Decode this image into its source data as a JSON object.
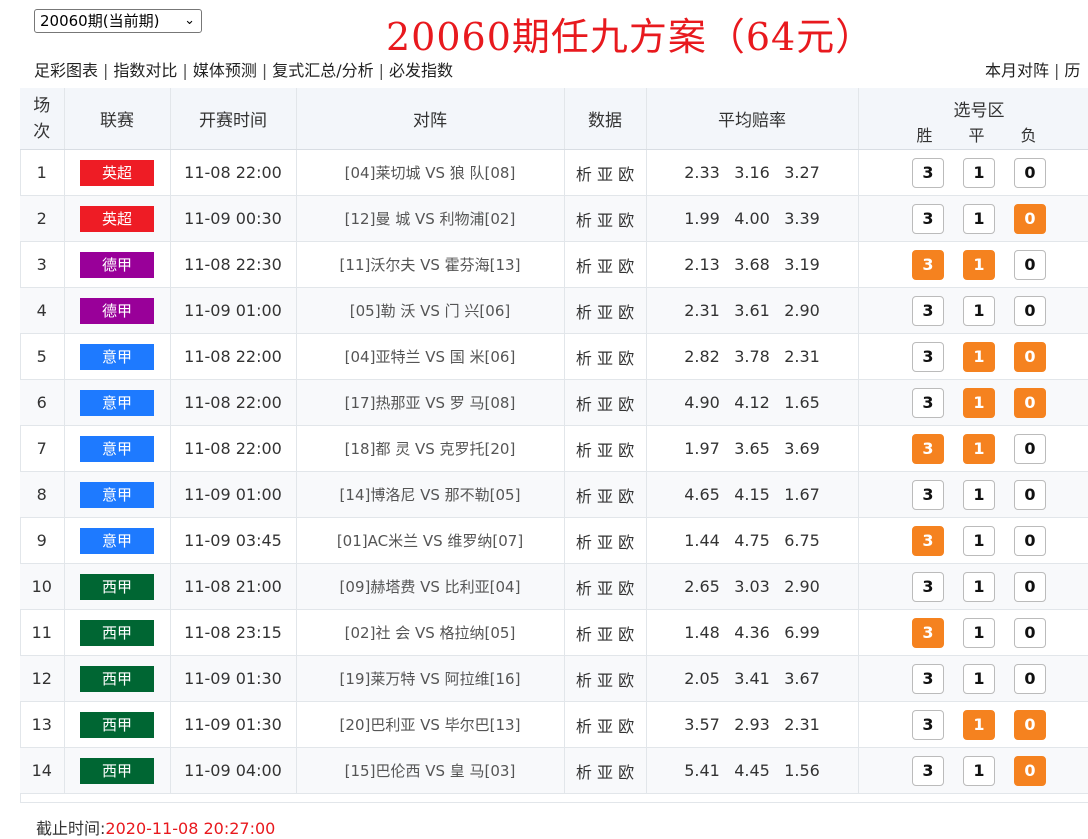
{
  "header": {
    "period_select": "20060期(当前期)",
    "title": "20060期任九方案（64元）",
    "nav": [
      "足彩图表",
      "指数对比",
      "媒体预测",
      "复式汇总/分析",
      "必发指数"
    ],
    "nav_right": [
      "本月对阵",
      "历"
    ]
  },
  "columns": {
    "no": "场次",
    "league": "联赛",
    "time": "开赛时间",
    "match": "对阵",
    "data": "数据",
    "odds": "平均赔率",
    "select": "选号区",
    "win": "胜",
    "draw": "平",
    "lose": "负"
  },
  "data_links": "析 亚 欧",
  "league_colors": {
    "英超": "#ee1c25",
    "德甲": "#990099",
    "意甲": "#1e7aff",
    "西甲": "#006633"
  },
  "pick_color": "#f5821f",
  "rows": [
    {
      "no": "1",
      "league": "英超",
      "time": "11-08 22:00",
      "match": "[04]莱切城 VS 狼 队[08]",
      "odds": [
        "2.33",
        "3.16",
        "3.27"
      ],
      "picks": [
        false,
        false,
        false
      ]
    },
    {
      "no": "2",
      "league": "英超",
      "time": "11-09 00:30",
      "match": "[12]曼 城 VS 利物浦[02]",
      "odds": [
        "1.99",
        "4.00",
        "3.39"
      ],
      "picks": [
        false,
        false,
        true
      ]
    },
    {
      "no": "3",
      "league": "德甲",
      "time": "11-08 22:30",
      "match": "[11]沃尔夫 VS 霍芬海[13]",
      "odds": [
        "2.13",
        "3.68",
        "3.19"
      ],
      "picks": [
        true,
        true,
        false
      ]
    },
    {
      "no": "4",
      "league": "德甲",
      "time": "11-09 01:00",
      "match": "[05]勒 沃 VS 门 兴[06]",
      "odds": [
        "2.31",
        "3.61",
        "2.90"
      ],
      "picks": [
        false,
        false,
        false
      ]
    },
    {
      "no": "5",
      "league": "意甲",
      "time": "11-08 22:00",
      "match": "[04]亚特兰 VS 国 米[06]",
      "odds": [
        "2.82",
        "3.78",
        "2.31"
      ],
      "picks": [
        false,
        true,
        true
      ]
    },
    {
      "no": "6",
      "league": "意甲",
      "time": "11-08 22:00",
      "match": "[17]热那亚 VS 罗 马[08]",
      "odds": [
        "4.90",
        "4.12",
        "1.65"
      ],
      "picks": [
        false,
        true,
        true
      ]
    },
    {
      "no": "7",
      "league": "意甲",
      "time": "11-08 22:00",
      "match": "[18]都 灵 VS 克罗托[20]",
      "odds": [
        "1.97",
        "3.65",
        "3.69"
      ],
      "picks": [
        true,
        true,
        false
      ]
    },
    {
      "no": "8",
      "league": "意甲",
      "time": "11-09 01:00",
      "match": "[14]博洛尼 VS 那不勒[05]",
      "odds": [
        "4.65",
        "4.15",
        "1.67"
      ],
      "picks": [
        false,
        false,
        false
      ]
    },
    {
      "no": "9",
      "league": "意甲",
      "time": "11-09 03:45",
      "match": "[01]AC米兰 VS 维罗纳[07]",
      "odds": [
        "1.44",
        "4.75",
        "6.75"
      ],
      "picks": [
        true,
        false,
        false
      ]
    },
    {
      "no": "10",
      "league": "西甲",
      "time": "11-08 21:00",
      "match": "[09]赫塔费 VS 比利亚[04]",
      "odds": [
        "2.65",
        "3.03",
        "2.90"
      ],
      "picks": [
        false,
        false,
        false
      ]
    },
    {
      "no": "11",
      "league": "西甲",
      "time": "11-08 23:15",
      "match": "[02]社 会 VS 格拉纳[05]",
      "odds": [
        "1.48",
        "4.36",
        "6.99"
      ],
      "picks": [
        true,
        false,
        false
      ]
    },
    {
      "no": "12",
      "league": "西甲",
      "time": "11-09 01:30",
      "match": "[19]莱万特 VS 阿拉维[16]",
      "odds": [
        "2.05",
        "3.41",
        "3.67"
      ],
      "picks": [
        false,
        false,
        false
      ]
    },
    {
      "no": "13",
      "league": "西甲",
      "time": "11-09 01:30",
      "match": "[20]巴利亚 VS 毕尔巴[13]",
      "odds": [
        "3.57",
        "2.93",
        "2.31"
      ],
      "picks": [
        false,
        true,
        true
      ]
    },
    {
      "no": "14",
      "league": "西甲",
      "time": "11-09 04:00",
      "match": "[15]巴伦西 VS 皇 马[03]",
      "odds": [
        "5.41",
        "4.45",
        "1.56"
      ],
      "picks": [
        false,
        false,
        true
      ]
    }
  ],
  "pick_labels": [
    "3",
    "1",
    "0"
  ],
  "footer": {
    "label": "截止时间:",
    "deadline": "2020-11-08 20:27:00"
  }
}
